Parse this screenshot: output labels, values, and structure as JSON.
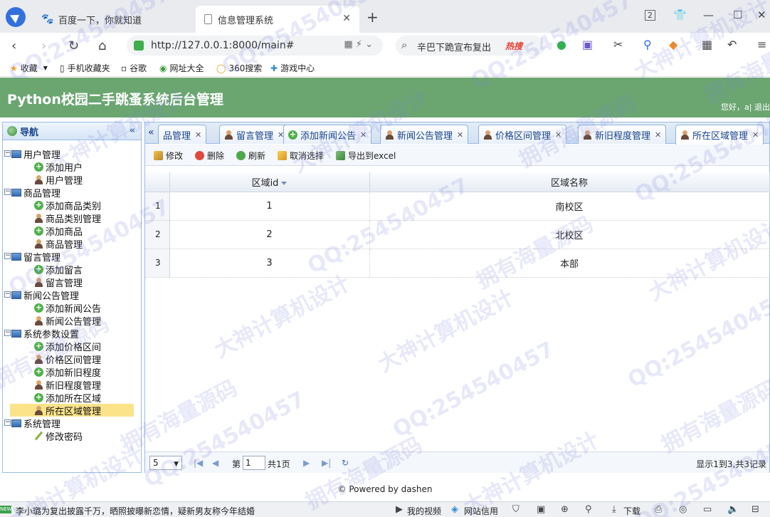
{
  "browser": {
    "tabs": [
      {
        "title": "百度一下，你就知道"
      },
      {
        "title": "信息管理系统"
      }
    ],
    "tab_counter": "2",
    "url": "http://127.0.0.1:8000/main#",
    "search_text": "辛巴下跪宣布复出",
    "hot_label": "热搜",
    "bookmarks": [
      "收藏",
      "手机收藏夹",
      "谷歌",
      "网址大全",
      "360搜索",
      "游戏中心"
    ]
  },
  "app": {
    "title": "Python校园二手跳蚤系统后台管理",
    "greeting": "您好，a| 退出"
  },
  "sidebar": {
    "title": "导航",
    "groups": [
      {
        "label": "用户管理",
        "items": [
          {
            "label": "添加用户",
            "icon": "add"
          },
          {
            "label": "用户管理",
            "icon": "user"
          }
        ]
      },
      {
        "label": "商品管理",
        "items": [
          {
            "label": "添加商品类别",
            "icon": "add"
          },
          {
            "label": "商品类别管理",
            "icon": "user"
          },
          {
            "label": "添加商品",
            "icon": "add"
          },
          {
            "label": "商品管理",
            "icon": "user"
          }
        ]
      },
      {
        "label": "留言管理",
        "items": [
          {
            "label": "添加留言",
            "icon": "add"
          },
          {
            "label": "留言管理",
            "icon": "user"
          }
        ]
      },
      {
        "label": "新闻公告管理",
        "items": [
          {
            "label": "添加新闻公告",
            "icon": "add"
          },
          {
            "label": "新闻公告管理",
            "icon": "user"
          }
        ]
      },
      {
        "label": "系统参数设置",
        "items": [
          {
            "label": "添加价格区间",
            "icon": "add"
          },
          {
            "label": "价格区间管理",
            "icon": "user"
          },
          {
            "label": "添加新旧程度",
            "icon": "add"
          },
          {
            "label": "新旧程度管理",
            "icon": "user"
          },
          {
            "label": "添加所在区域",
            "icon": "add"
          },
          {
            "label": "所在区域管理",
            "icon": "user",
            "selected": true
          }
        ]
      },
      {
        "label": "系统管理",
        "items": [
          {
            "label": "修改密码",
            "icon": "pencil"
          }
        ]
      }
    ]
  },
  "tabs": [
    {
      "label": "品管理",
      "icon": "none"
    },
    {
      "label": "留言管理",
      "icon": "user"
    },
    {
      "label": "添加新闻公告",
      "icon": "add"
    },
    {
      "label": "新闻公告管理",
      "icon": "user"
    },
    {
      "label": "价格区间管理",
      "icon": "user"
    },
    {
      "label": "新旧程度管理",
      "icon": "user"
    },
    {
      "label": "所在区域管理",
      "icon": "user",
      "active": true
    }
  ],
  "toolbar": {
    "edit": "修改",
    "delete": "删除",
    "refresh": "刷新",
    "cancel_select": "取消选择",
    "export": "导出到excel"
  },
  "grid": {
    "columns": [
      "区域id",
      "区域名称"
    ],
    "rows": [
      {
        "num": "1",
        "id": "1",
        "name": "南校区"
      },
      {
        "num": "2",
        "id": "2",
        "name": "北校区"
      },
      {
        "num": "3",
        "id": "3",
        "name": "本部"
      }
    ]
  },
  "pager": {
    "page_size": "5",
    "page_label_pre": "第",
    "page_value": "1",
    "page_label_post": "共1页",
    "info": "显示1到3,共3记录"
  },
  "footer": "© Powered by dashen",
  "statusbar": {
    "news_badge": "NEW",
    "news": "李小璐为复出披露千万，晒照披曝新恋情，疑新男友称今年结婚",
    "my_video": "我的视频",
    "credit": "网站信用",
    "download": "下载"
  },
  "watermarks": [
    "QQ:254540457",
    "大神计算机设计",
    "拥有海量源码"
  ]
}
